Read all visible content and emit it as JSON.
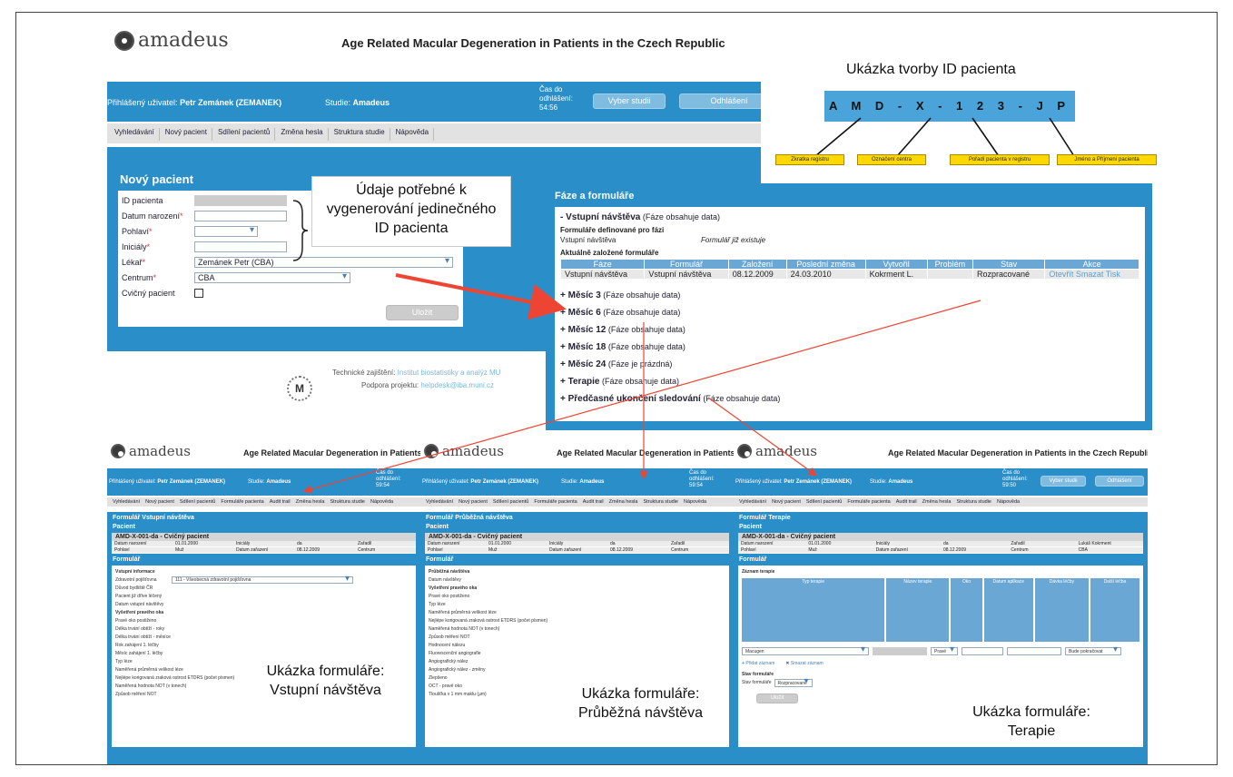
{
  "app": {
    "logo_text": "amadeus",
    "title": "Age Related Macular Degeneration in Patients in the Czech Republic",
    "logged_label": "Přihlášený uživatel:",
    "logged_user": "Petr Zemánek (ZEMANEK)",
    "study_label": "Studie:",
    "study_name": "Amadeus",
    "time_label": "Čas do odhlášení:",
    "time_value": "54:56",
    "choose_study_btn": "Vyber studii",
    "logout_btn": "Odhlášení"
  },
  "menu": [
    "Vyhledávání",
    "Nový pacient",
    "Sdílení pacientů",
    "Změna hesla",
    "Struktura studie",
    "Nápověda"
  ],
  "new_patient": {
    "title": "Nový pacient",
    "fields": [
      {
        "label": "ID pacienta",
        "required": false,
        "value": "",
        "type": "ro"
      },
      {
        "label": "Datum narození",
        "required": true,
        "value": "",
        "type": "text"
      },
      {
        "label": "Pohlaví",
        "required": true,
        "value": "",
        "type": "select"
      },
      {
        "label": "Iniciály",
        "required": true,
        "value": "",
        "type": "text"
      },
      {
        "label": "Lékař",
        "required": true,
        "value": "Zemánek Petr (CBA)",
        "type": "select"
      },
      {
        "label": "Centrum",
        "required": true,
        "value": "CBA",
        "type": "select"
      },
      {
        "label": "Cvičný pacient",
        "required": false,
        "value": "",
        "type": "checkbox"
      }
    ],
    "save_btn": "Uložit"
  },
  "footer": {
    "tech_label": "Technické zajištění:",
    "tech_value": "Institut biostatistiky a analýz MU",
    "support_label": "Podpora projektu:",
    "support_value": "helpdesk@iba.muni.cz"
  },
  "callout_id": "Údaje potřebné k vygenerování jedinečného ID pacienta",
  "id_demo": {
    "title": "Ukázka tvorby ID pacienta",
    "id": "A M D - X - 1 2 3 - J P",
    "tags": [
      "Zkratka registru",
      "Označení centra",
      "Pořadí pacienta v registru",
      "Jméno a Příjmení pacienta"
    ]
  },
  "phases": {
    "title": "Fáze a formuláře",
    "first": {
      "name": "Vstupní návštěva",
      "note": "(Fáze obsahuje data)"
    },
    "defined_label": "Formuláře definované pro fázi",
    "defined_form": "Vstupní návštěva",
    "defined_status": "Formulář již existuje",
    "created_label": "Aktuálně založené formuláře",
    "table_headers": [
      "Fáze",
      "Formulář",
      "Založení",
      "Poslední změna",
      "Vytvořil",
      "Problém",
      "Stav",
      "Akce"
    ],
    "table_row": [
      "Vstupní návštěva",
      "Vstupní návštěva",
      "08.12.2009",
      "24.03.2010",
      "Kokrment L.",
      "",
      "Rozpracované"
    ],
    "actions": [
      "Otevřít",
      "Smazat",
      "Tisk"
    ],
    "others": [
      {
        "name": "Měsíc 3",
        "note": "(Fáze obsahuje data)"
      },
      {
        "name": "Měsíc 6",
        "note": "(Fáze obsahuje data)"
      },
      {
        "name": "Měsíc 12",
        "note": "(Fáze obsahuje data)"
      },
      {
        "name": "Měsíc 18",
        "note": "(Fáze obsahuje data)"
      },
      {
        "name": "Měsíc 24",
        "note": "(Fáze je prázdná)"
      },
      {
        "name": "Terapie",
        "note": "(Fáze obsahuje data)"
      },
      {
        "name": "Předčasné ukončení sledování",
        "note": "(Fáze obsahuje data)"
      }
    ]
  },
  "shots": {
    "menu": [
      "Vyhledávání",
      "Nový pacient",
      "Sdílení pacientů",
      "Formuláře pacienta",
      "Audit trail",
      "Změna hesla",
      "Struktura studie",
      "Nápověda"
    ],
    "pacient_label": "Pacient",
    "patient_id": "AMD-X-001-da - Cvičný pacient",
    "pat_row1": [
      "Datum narození",
      "01.01.2000",
      "Iniciály",
      "da",
      "Zařadil"
    ],
    "pat_row2": [
      "Pohlaví",
      "Muž",
      "Datum zařazení",
      "08.12.2009",
      "Centrum"
    ],
    "form_label": "Formulář",
    "s1": {
      "title": "Formulář Vstupní návštěva",
      "time": "59:54",
      "rows": [
        "Vstupní informace",
        "Zdravotní pojišťovna",
        "Důvod bydliště ČR",
        "Pacient již dříve léčený",
        "Datum vstupní návštěvy",
        "Vyšetření pravého oka",
        "Pravé oko postiženo",
        "Délka trvání obtíží - roky",
        "Délka trvání obtíží - měsíce",
        "Rok zahájení 1. léčby",
        "Měsíc zahájení 1. léčby",
        "Typ léze",
        "Naměřená průměrná velikost léze",
        "Nejlépe korigovaná zraková ostrost ETDRS (počet písmen)",
        "Naměřená hodnota NOT (v tonech)",
        "Způsob měření NOT"
      ],
      "insurer": "111 - Všeobecná zdravotní pojišťovna",
      "callout": "Ukázka formuláře: Vstupní návštěva"
    },
    "s2": {
      "title": "Formulář Průběžná návštěva",
      "time": "59:54",
      "rows": [
        "Průběžná návštěva",
        "Datum návštěvy",
        "Vyšetření pravého oka",
        "Pravé oko postiženo",
        "Typ léze",
        "Naměřená průměrná velikost léze",
        "Nejlépe korigovaná zraková ostrost ETDRS (počet písmen)",
        "Naměřená hodnota NOT (v tonech)",
        "Způsob měření NOT",
        "Hodnocení nálezu",
        "Fluorescenční angiografie",
        "Angiografický nález",
        "Angiografický nález - změny",
        "Zlepšeno",
        "OCT - pravé oko",
        "Tloušťka v 1 mm maklu (µm)"
      ],
      "callout": "Ukázka formuláře: Průběžná návštěva"
    },
    "s3": {
      "title": "Formulář Terapie",
      "time": "59:50",
      "extra1": [
        "Lukáš Kokrment",
        "CBA"
      ],
      "record_label": "Záznam terapie",
      "cols": [
        "Typ terapie",
        "Název terapie",
        "Oko",
        "Datum aplikace",
        "Dávka léčby",
        "Další léčba"
      ],
      "drug": "Macugen",
      "eye": "Pravé",
      "next": "Bude pokračovat",
      "add": "Přidat záznam",
      "del": "Smazat záznam",
      "state_label": "Stav formuláře",
      "state_field": "Stav formuláře",
      "state_value": "Rozpracované",
      "save": "Uložit",
      "callout": "Ukázka formuláře: Terapie"
    }
  },
  "colors": {
    "brand_blue": "#2a8fc9",
    "arrow": "#ee4433",
    "tag_yellow": "#ffd800"
  }
}
